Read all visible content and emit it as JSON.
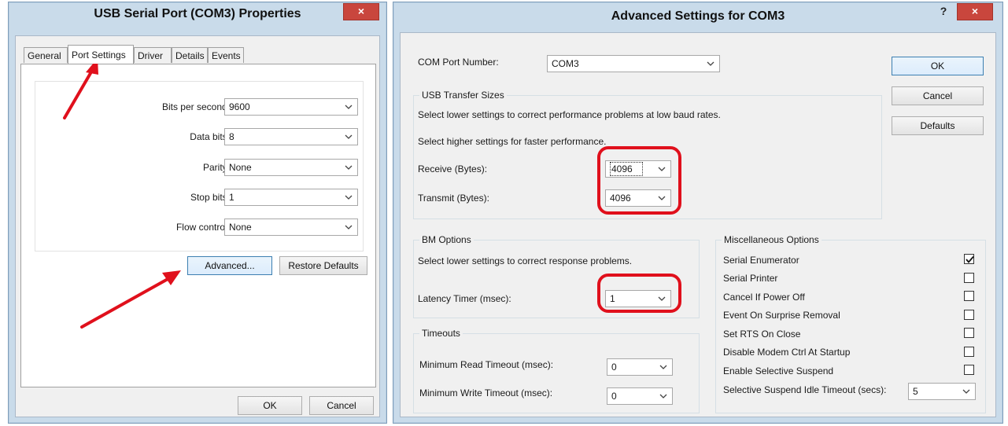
{
  "left_window": {
    "title": "USB Serial Port (COM3) Properties",
    "close_label": "×",
    "tabs": [
      {
        "label": "General"
      },
      {
        "label": "Port Settings"
      },
      {
        "label": "Driver"
      },
      {
        "label": "Details"
      },
      {
        "label": "Events"
      }
    ],
    "fields": [
      {
        "label": "Bits per second:",
        "value": "9600"
      },
      {
        "label": "Data bits:",
        "value": "8"
      },
      {
        "label": "Parity:",
        "value": "None"
      },
      {
        "label": "Stop bits:",
        "value": "1"
      },
      {
        "label": "Flow control:",
        "value": "None"
      }
    ],
    "advanced_label": "Advanced...",
    "restore_label": "Restore Defaults",
    "ok_label": "OK",
    "cancel_label": "Cancel"
  },
  "right_window": {
    "title": "Advanced Settings for COM3",
    "help_label": "?",
    "close_label": "×",
    "com_port_label": "COM Port Number:",
    "com_port_value": "COM3",
    "ok_label": "OK",
    "cancel_label": "Cancel",
    "defaults_label": "Defaults",
    "usb_group": {
      "title": "USB Transfer Sizes",
      "line1": "Select lower settings to correct performance problems at low baud rates.",
      "line2": "Select higher settings for faster performance.",
      "receive_label": "Receive (Bytes):",
      "receive_value": "4096",
      "transmit_label": "Transmit (Bytes):",
      "transmit_value": "4096"
    },
    "bm_group": {
      "title": "BM Options",
      "line1": "Select lower settings to correct response problems.",
      "latency_label": "Latency Timer (msec):",
      "latency_value": "1"
    },
    "timeouts_group": {
      "title": "Timeouts",
      "read_label": "Minimum Read Timeout (msec):",
      "read_value": "0",
      "write_label": "Minimum Write Timeout (msec):",
      "write_value": "0"
    },
    "misc_group": {
      "title": "Miscellaneous Options",
      "options": [
        {
          "label": "Serial Enumerator",
          "checked": true
        },
        {
          "label": "Serial Printer",
          "checked": false
        },
        {
          "label": "Cancel If Power Off",
          "checked": false
        },
        {
          "label": "Event On Surprise Removal",
          "checked": false
        },
        {
          "label": "Set RTS On Close",
          "checked": false
        },
        {
          "label": "Disable Modem Ctrl At Startup",
          "checked": false
        },
        {
          "label": "Enable Selective Suspend",
          "checked": false
        }
      ],
      "idle_timeout_label": "Selective Suspend Idle Timeout (secs):",
      "idle_timeout_value": "5"
    }
  },
  "colors": {
    "annotation_red": "#e0101c",
    "close_button": "#c9463d",
    "frame": "#c9dbea"
  }
}
